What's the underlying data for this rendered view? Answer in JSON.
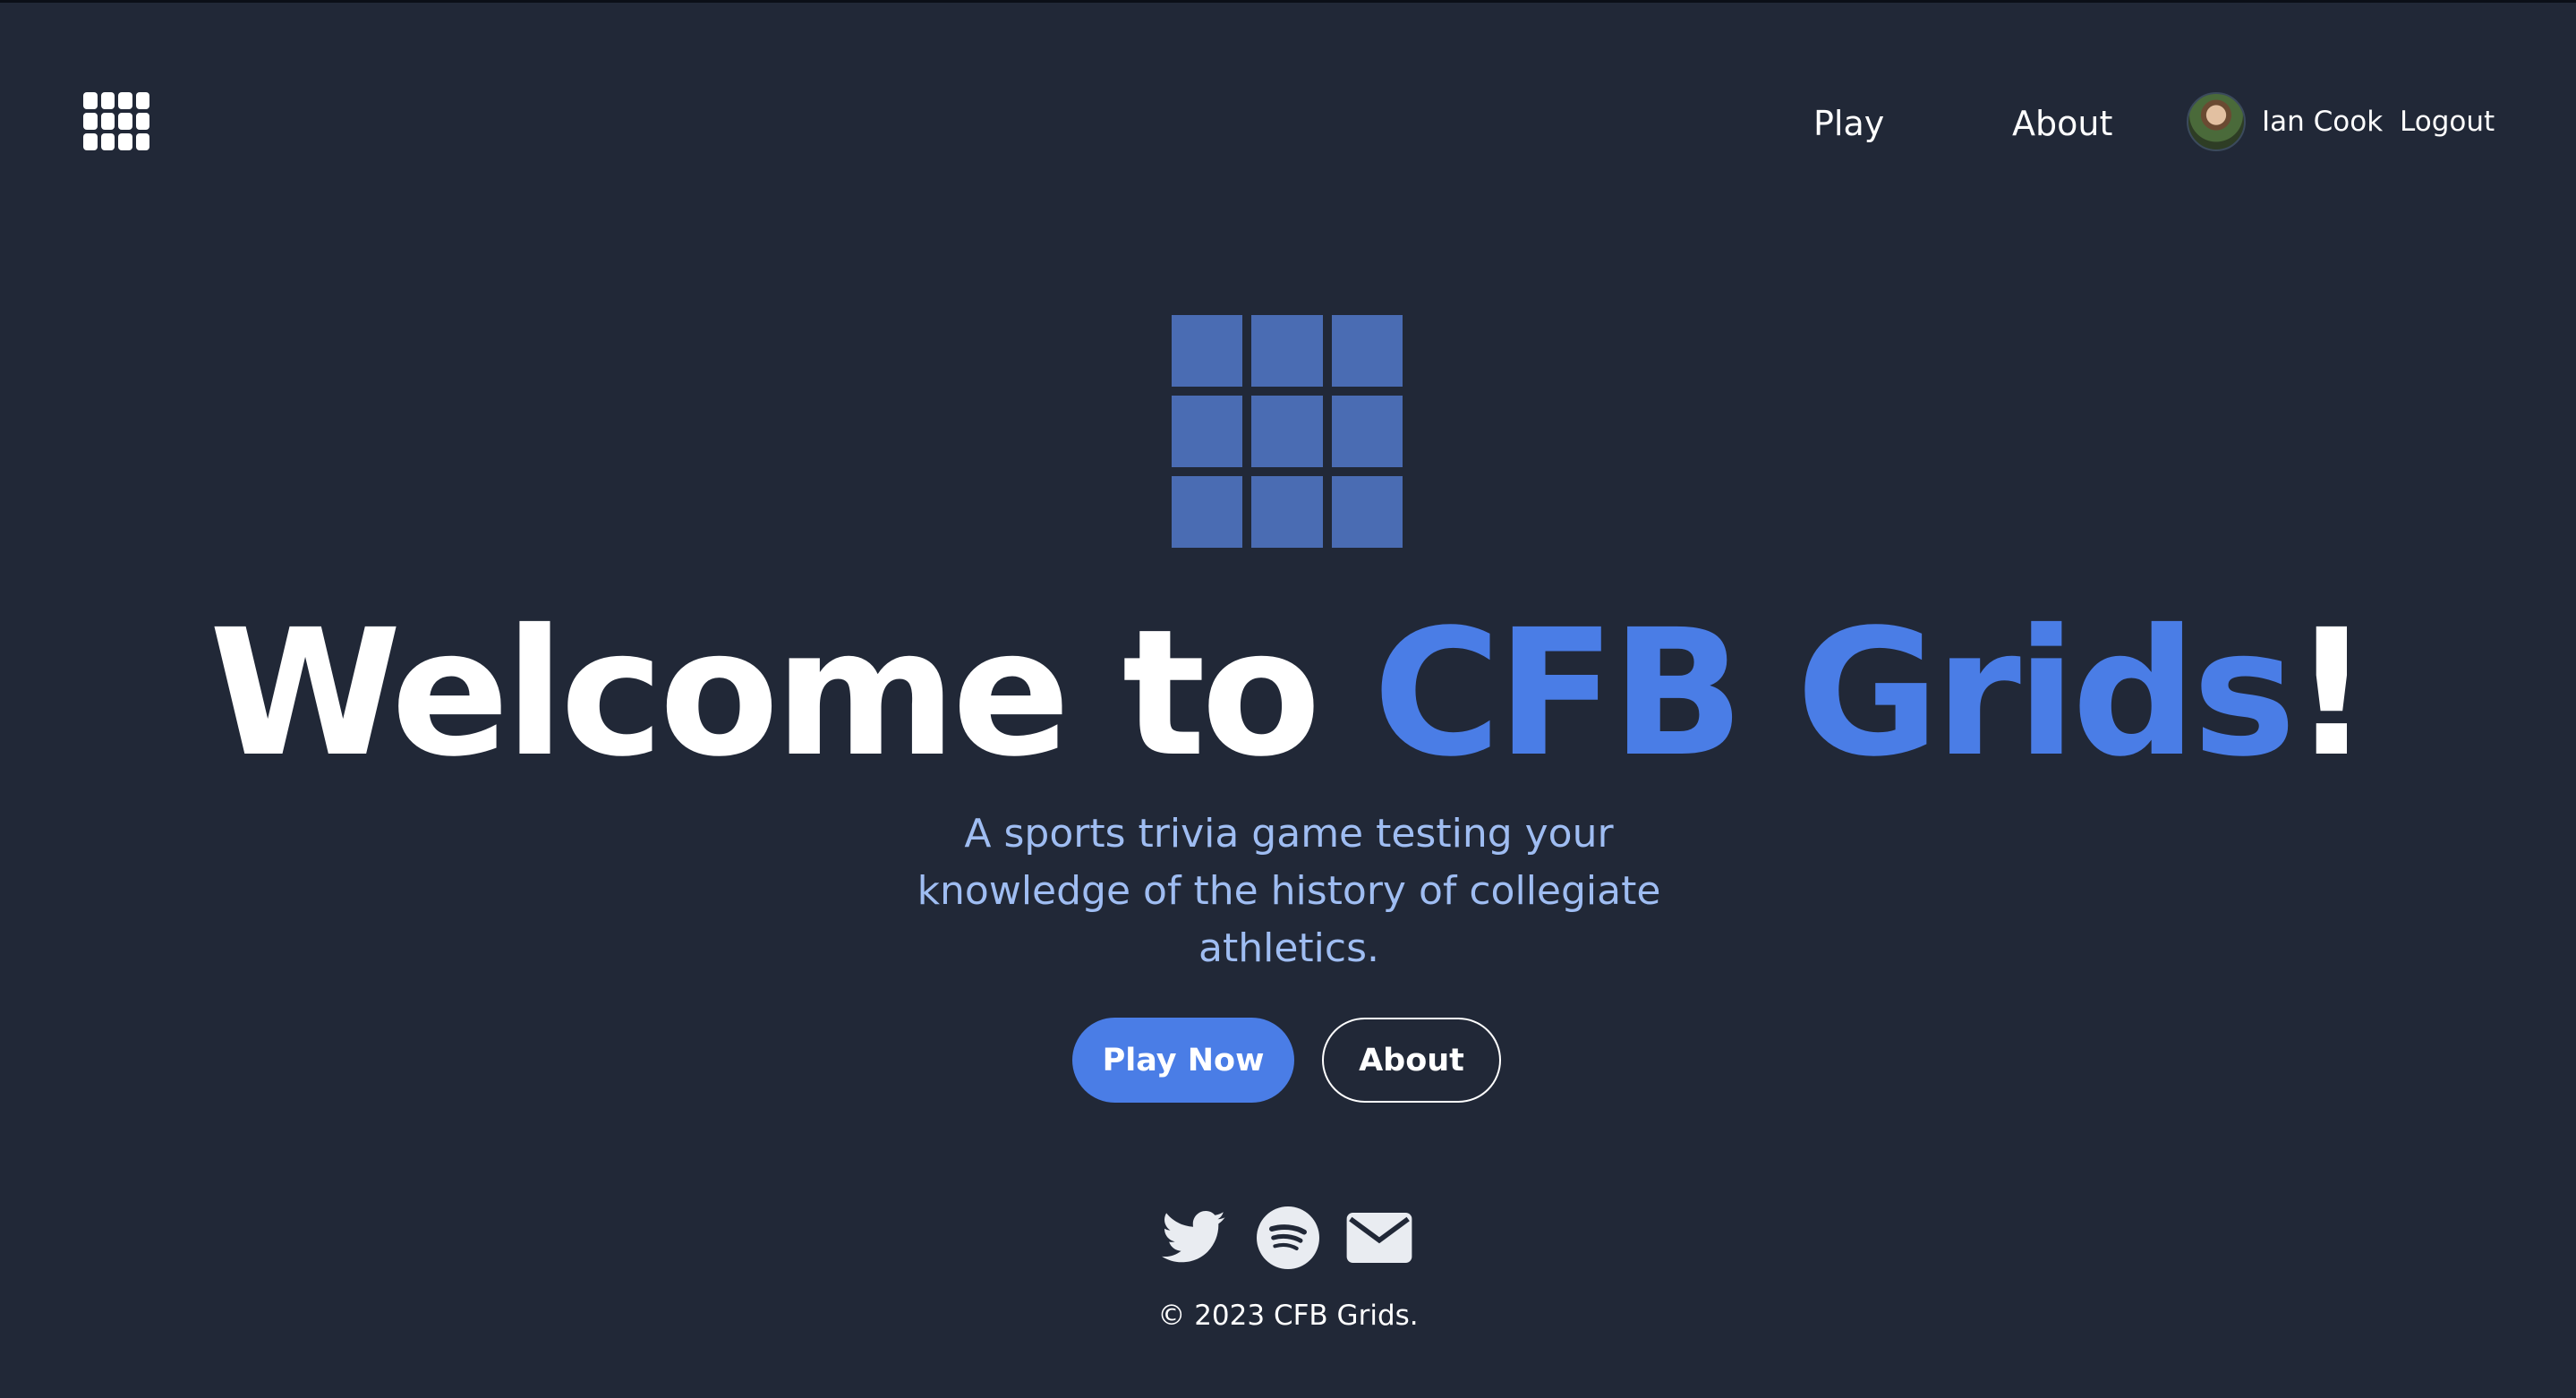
{
  "header": {
    "nav": {
      "play_label": "Play",
      "about_label": "About"
    },
    "user": {
      "name": "Ian Cook",
      "logout_label": "Logout"
    }
  },
  "hero": {
    "title_prefix": "Welcome to ",
    "title_accent": "CFB Grids",
    "title_suffix": "!",
    "subtitle": "A sports trivia game testing your knowledge of the history of collegiate athletics.",
    "buttons": {
      "play_now_label": "Play Now",
      "about_label": "About"
    }
  },
  "footer": {
    "social_icons": [
      "twitter-icon",
      "spotify-icon",
      "mail-icon"
    ],
    "copyright": "© 2023 CFB Grids."
  },
  "colors": {
    "background": "#212837",
    "accent": "#4a7de6",
    "grid_tile": "#4a6cb3",
    "subtitle": "#9fbdf2",
    "text": "#ffffff"
  }
}
